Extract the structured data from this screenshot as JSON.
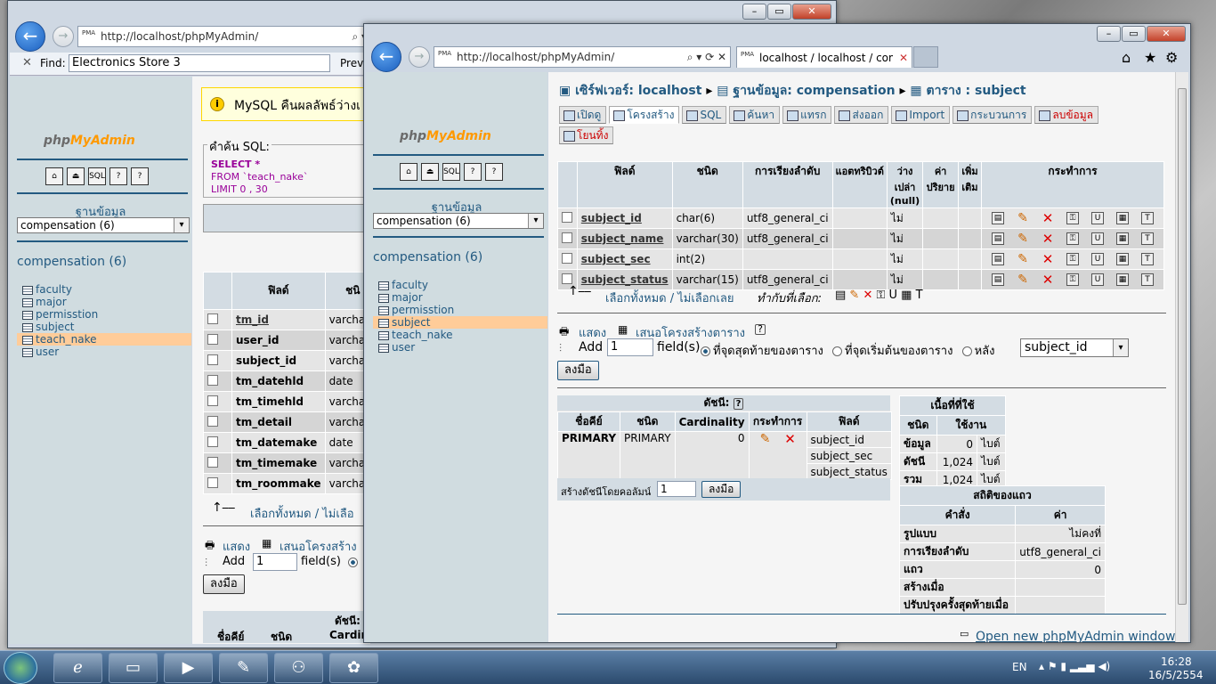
{
  "back_window": {
    "address": "http://localhost/phpMyAdmin/",
    "find_label": "Find:",
    "find_value": "Electronics Store 3",
    "find_prev": "Previ",
    "nav_db_header": "ฐานข้อมูล",
    "nav_db_select": "compensation (6)",
    "nav_db_link": "compensation (6)",
    "nav_tables": [
      "faculty",
      "major",
      "permisstion",
      "subject",
      "teach_nake",
      "user"
    ],
    "nav_selected": "teach_nake",
    "notice": "MySQL คืนผลลัพธ์ว่างเ",
    "sql_label": "คำค้น SQL:",
    "sql_line1": "SELECT *",
    "sql_line2": "FROM `teach_nake`",
    "sql_line3": "LIMIT 0 , 30",
    "col_field": "ฟิลด์",
    "col_type": "ชนิ",
    "rows": [
      {
        "name": "tm_id",
        "type": "varchar(",
        "key": true
      },
      {
        "name": "user_id",
        "type": "varchar(",
        "key": false
      },
      {
        "name": "subject_id",
        "type": "varchar(",
        "key": false
      },
      {
        "name": "tm_datehld",
        "type": "date",
        "key": false
      },
      {
        "name": "tm_timehld",
        "type": "varchar(",
        "key": false
      },
      {
        "name": "tm_detail",
        "type": "varchar(",
        "key": false
      },
      {
        "name": "tm_datemake",
        "type": "date",
        "key": false
      },
      {
        "name": "tm_timemake",
        "type": "varchar(",
        "key": false
      },
      {
        "name": "tm_roommake",
        "type": "varchar(",
        "key": false
      }
    ],
    "check_all": "เลือกทั้งหมด / ไม่เลือ",
    "show_link": "แสดง",
    "propose_link": "เสนอโครงสร้าง",
    "add_label": "Add",
    "add_value": "1",
    "fields_label": "field(s)",
    "go_button": "ลงมือ",
    "index_label": "ดัชนี:",
    "index_key": "ชื่อคีย์",
    "index_type": "ชนิด",
    "index_card": "Cardin"
  },
  "front_window": {
    "address": "http://localhost/phpMyAdmin/",
    "tab_title": "localhost / localhost / com...",
    "nav_db_header": "ฐานข้อมูล",
    "nav_db_select": "compensation (6)",
    "nav_db_link": "compensation (6)",
    "nav_tables": [
      "faculty",
      "major",
      "permisstion",
      "subject",
      "teach_nake",
      "user"
    ],
    "nav_selected": "subject",
    "breadcrumb": {
      "server": "เซิร์ฟเวอร์: localhost",
      "db": "ฐานข้อมูล: compensation",
      "table": "ตาราง : subject"
    },
    "tabs": [
      "เปิดดู",
      "โครงสร้าง",
      "SQL",
      "ค้นหา",
      "แทรก",
      "ส่งออก",
      "Import",
      "กระบวนการ",
      "ลบข้อมูล",
      "โยนทิ้ง"
    ],
    "active_tab": "โครงสร้าง",
    "structure_headers": [
      "ฟิลด์",
      "ชนิด",
      "การเรียงลำดับ",
      "แอตทริบิวต์",
      "ว่างเปล่า (null)",
      "ค่าปริยาย",
      "เพิ่มเติม",
      "กระทำการ"
    ],
    "fields": [
      {
        "name": "subject_id",
        "type": "char(6)",
        "collation": "utf8_general_ci",
        "null": "ไม่"
      },
      {
        "name": "subject_name",
        "type": "varchar(30)",
        "collation": "utf8_general_ci",
        "null": "ไม่"
      },
      {
        "name": "subject_sec",
        "type": "int(2)",
        "collation": "",
        "null": "ไม่"
      },
      {
        "name": "subject_status",
        "type": "varchar(15)",
        "collation": "utf8_general_ci",
        "null": "ไม่"
      }
    ],
    "check_all": "เลือกทั้งหมด / ไม่เลือกเลย",
    "with_selected": "ทำกับที่เลือก:",
    "show_link": "แสดง",
    "propose_link": "เสนอโครงสร้างตาราง",
    "add_label": "Add",
    "add_value": "1",
    "fields_label": "field(s)",
    "opt_end": "ที่จุดสุดท้ายของตาราง",
    "opt_begin": "ที่จุดเริ่มต้นของตาราง",
    "opt_after": "หลัง",
    "after_select": "subject_id",
    "go_button": "ลงมือ",
    "index_title": "ดัชนี:",
    "index_headers": [
      "ชื่อคีย์",
      "ชนิด",
      "Cardinality",
      "กระทำการ",
      "ฟิลด์"
    ],
    "index_row": {
      "key": "PRIMARY",
      "type": "PRIMARY",
      "card": "0",
      "fields": [
        "subject_id",
        "subject_sec",
        "subject_status"
      ]
    },
    "create_index_label": "สร้างดัชนีโดยคอลัมน์",
    "create_index_value": "1",
    "create_index_go": "ลงมือ",
    "space_title": "เนื้อที่ที่ใช้",
    "space_headers": [
      "ชนิด",
      "ใช้งาน"
    ],
    "space_rows": [
      [
        "ข้อมูล",
        "0",
        "ไบต์"
      ],
      [
        "ดัชนี",
        "1,024",
        "ไบต์"
      ],
      [
        "รวม",
        "1,024",
        "ไบต์"
      ]
    ],
    "stats_title": "สถิติของแถว",
    "stats_headers": [
      "คำสั่ง",
      "ค่า"
    ],
    "stats_rows": [
      [
        "รูปแบบ",
        "ไม่คงที่"
      ],
      [
        "การเรียงลำดับ",
        "utf8_general_ci"
      ],
      [
        "แถว",
        "0"
      ],
      [
        "สร้างเมื่อ",
        ""
      ],
      [
        "ปรับปรุงครั้งสุดท้ายเมื่อ",
        ""
      ]
    ],
    "open_new": "Open new phpMyAdmin window"
  },
  "taskbar": {
    "lang": "EN",
    "time": "16:28",
    "date": "16/5/2554"
  },
  "colors": {
    "link": "#235a81",
    "header": "#d3dce3",
    "row": "#e5e5e5",
    "selected": "#ffcc99"
  }
}
